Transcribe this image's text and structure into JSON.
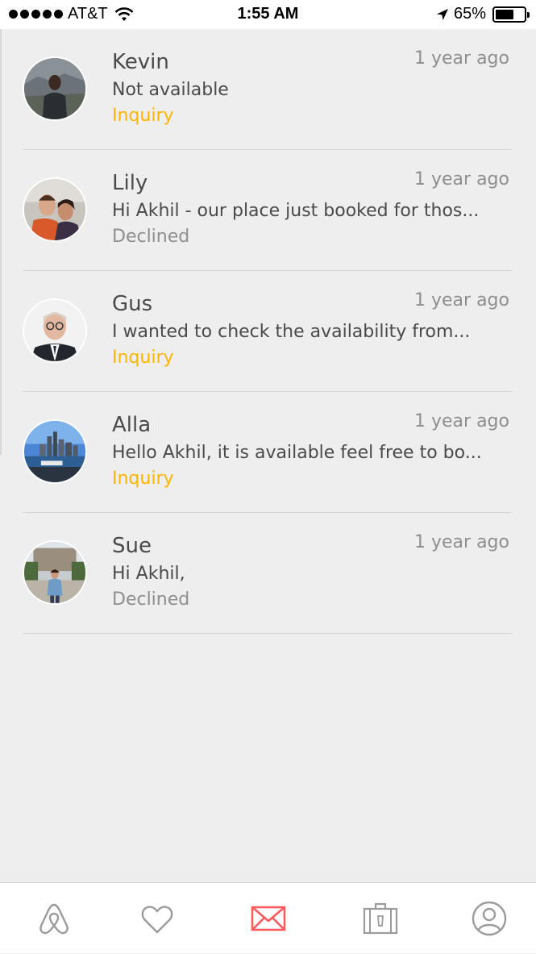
{
  "status_bar": {
    "carrier": "AT&T",
    "time": "1:55 AM",
    "battery": "65%",
    "battery_level": 0.65
  },
  "threads": [
    {
      "name": "Kevin",
      "time": "1 year ago",
      "preview": "Not available",
      "status": "Inquiry",
      "status_type": "inquiry"
    },
    {
      "name": "Lily",
      "time": "1 year ago",
      "preview": "Hi Akhil - our place just booked for thos...",
      "status": "Declined",
      "status_type": "declined"
    },
    {
      "name": "Gus",
      "time": "1 year ago",
      "preview": "I wanted to check the availability from...",
      "status": "Inquiry",
      "status_type": "inquiry"
    },
    {
      "name": "Alla",
      "time": "1 year ago",
      "preview": "Hello Akhil, it is available feel free to bo...",
      "status": "Inquiry",
      "status_type": "inquiry"
    },
    {
      "name": "Sue",
      "time": "1 year ago",
      "preview": "Hi Akhil,",
      "status": "Declined",
      "status_type": "declined"
    }
  ],
  "tab_bar": {
    "active": "inbox",
    "active_color": "#ff5a5f",
    "inactive_color": "#9b9b9b",
    "tabs": [
      {
        "id": "explore",
        "icon": "airbnb-logo-icon"
      },
      {
        "id": "wishlists",
        "icon": "heart-icon"
      },
      {
        "id": "inbox",
        "icon": "envelope-icon"
      },
      {
        "id": "trips",
        "icon": "suitcase-icon"
      },
      {
        "id": "profile",
        "icon": "user-circle-icon"
      }
    ]
  },
  "colors": {
    "inquiry": "#ffb400",
    "declined": "#8e8e8e",
    "background": "#eeeeee"
  }
}
